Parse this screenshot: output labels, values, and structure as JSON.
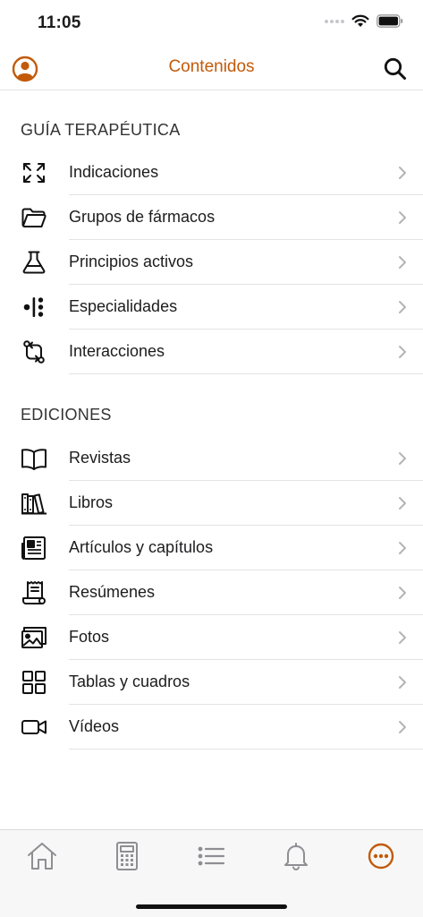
{
  "status": {
    "time": "11:05"
  },
  "nav": {
    "title": "Contenidos"
  },
  "sections": [
    {
      "title": "GUÍA TERAPÉUTICA",
      "items": [
        {
          "label": "Indicaciones",
          "icon": "expand-arrows-icon"
        },
        {
          "label": "Grupos de fármacos",
          "icon": "folder-icon"
        },
        {
          "label": "Principios activos",
          "icon": "flask-icon"
        },
        {
          "label": "Especialidades",
          "icon": "pills-dots-icon"
        },
        {
          "label": "Interacciones",
          "icon": "interactions-icon"
        }
      ]
    },
    {
      "title": "EDICIONES",
      "items": [
        {
          "label": "Revistas",
          "icon": "open-book-icon"
        },
        {
          "label": "Libros",
          "icon": "books-icon"
        },
        {
          "label": "Artículos y capítulos",
          "icon": "newspaper-icon"
        },
        {
          "label": "Resúmenes",
          "icon": "scroll-icon"
        },
        {
          "label": "Fotos",
          "icon": "photos-icon"
        },
        {
          "label": "Tablas y cuadros",
          "icon": "grid-icon"
        },
        {
          "label": "Vídeos",
          "icon": "video-camera-icon"
        }
      ]
    }
  ],
  "tabs": [
    {
      "name": "home",
      "icon": "home-icon",
      "active": false
    },
    {
      "name": "calculator",
      "icon": "calculator-icon",
      "active": false
    },
    {
      "name": "list",
      "icon": "list-icon",
      "active": false
    },
    {
      "name": "notifications",
      "icon": "bell-icon",
      "active": false
    },
    {
      "name": "more",
      "icon": "more-icon",
      "active": true
    }
  ],
  "colors": {
    "accent": "#c25a0a",
    "inactive_tab": "#8e8e93",
    "separator": "#e3e3e6"
  }
}
